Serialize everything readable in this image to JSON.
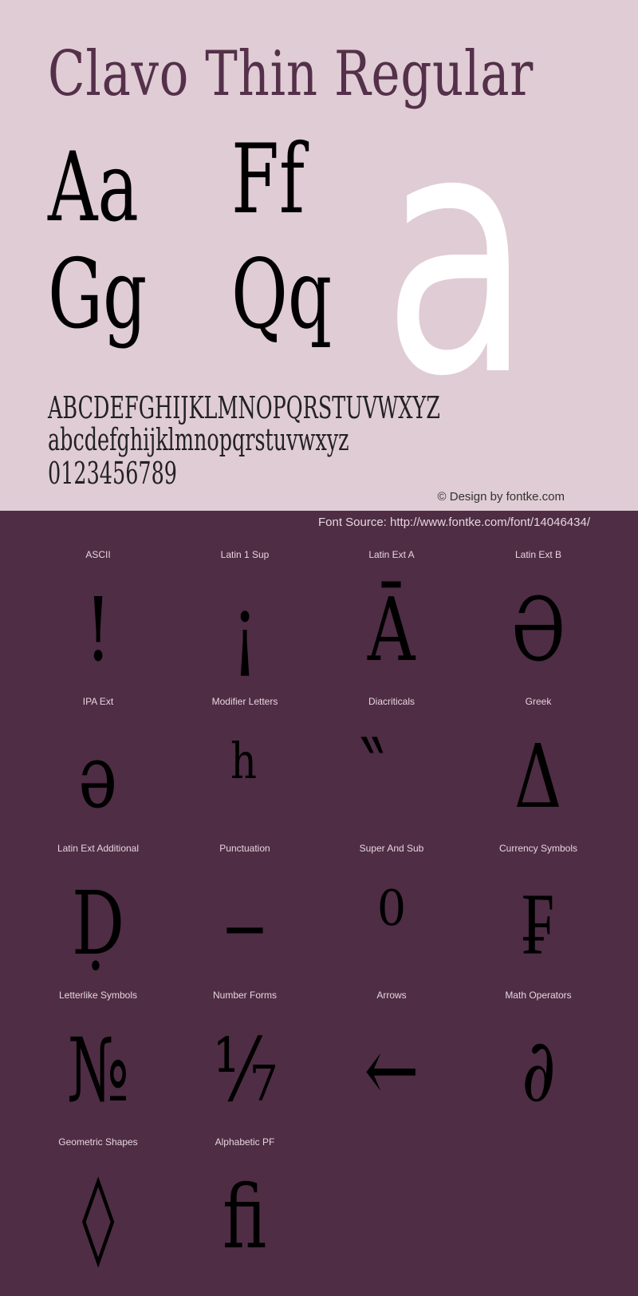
{
  "header": {
    "title": "Clavo Thin Regular",
    "pairs": [
      "Aa",
      "Ff",
      "Gg",
      "Qq"
    ],
    "big_glyph": "a"
  },
  "alphabet": {
    "uppercase": "ABCDEFGHIJKLMNOPQRSTUVWXYZ",
    "lowercase": "abcdefghijklmnopqrstuvwxyz",
    "digits": "0123456789"
  },
  "credit": "© Design by fontke.com",
  "source": "Font Source: http://www.fontke.com/font/14046434/",
  "colors": {
    "top_background": "#e0ccd4",
    "bottom_background": "#4f2d45",
    "title_color": "#54304a",
    "big_glyph_color": "#ffffff"
  },
  "blocks": [
    {
      "label": "ASCII",
      "glyph": "!"
    },
    {
      "label": "Latin 1 Sup",
      "glyph": "¡"
    },
    {
      "label": "Latin Ext A",
      "glyph": "Ā"
    },
    {
      "label": "Latin Ext B",
      "glyph": "Ə"
    },
    {
      "label": "IPA Ext",
      "glyph": "ə"
    },
    {
      "label": "Modifier Letters",
      "glyph": "ʰ"
    },
    {
      "label": "Diacriticals",
      "glyph": "̏"
    },
    {
      "label": "Greek",
      "glyph": "Δ"
    },
    {
      "label": "Latin Ext Additional",
      "glyph": "Ḍ"
    },
    {
      "label": "Punctuation",
      "glyph": "‒"
    },
    {
      "label": "Super And Sub",
      "glyph": "⁰"
    },
    {
      "label": "Currency Symbols",
      "glyph": "₣"
    },
    {
      "label": "Letterlike Symbols",
      "glyph": "№"
    },
    {
      "label": "Number Forms",
      "glyph": "⅐"
    },
    {
      "label": "Arrows",
      "glyph": "←"
    },
    {
      "label": "Math Operators",
      "glyph": "∂"
    },
    {
      "label": "Geometric Shapes",
      "glyph": "◊"
    },
    {
      "label": "Alphabetic PF",
      "glyph": "ﬁ"
    }
  ]
}
